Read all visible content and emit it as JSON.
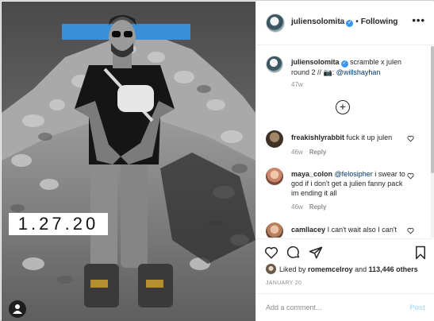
{
  "photo": {
    "date_overlay": "1.27.20"
  },
  "header": {
    "username": "juliensolomita",
    "separator": "•",
    "follow_status": "Following",
    "more": "•••"
  },
  "caption": {
    "username": "juliensolomita",
    "text": "scramble x julen round 2 //",
    "camera_emoji": "📷",
    "mention": "@willshayhan",
    "age": "47w"
  },
  "comments": [
    {
      "username": "freakishlyrabbit",
      "text": "fuck it up julen",
      "age": "46w",
      "reply": "Reply"
    },
    {
      "username": "maya_colon",
      "mention": "@felosipher",
      "text": "i swear to god if i don't get a julien fanny pack im ending it all",
      "age": "46w",
      "reply": "Reply"
    },
    {
      "username": "camllacey",
      "text": "I can't wait also I can't"
    }
  ],
  "likes": {
    "prefix": "Liked by",
    "user": "romemcelroy",
    "conj": "and",
    "count": "113,446 others"
  },
  "post_date": "JANUARY 20",
  "add_comment": {
    "placeholder": "Add a comment...",
    "post_label": "Post"
  },
  "icons": {
    "heart": "heart-icon",
    "comment": "comment-icon",
    "share": "share-icon",
    "save": "bookmark-icon",
    "load_more": "plus-circle-icon",
    "user_tag": "user-tag-icon"
  },
  "colors": {
    "verified": "#3897f0",
    "link": "#00376b",
    "muted": "#8e8e8e",
    "post_disabled": "#b2dffc",
    "sign_blue": "#3b8fd6"
  }
}
